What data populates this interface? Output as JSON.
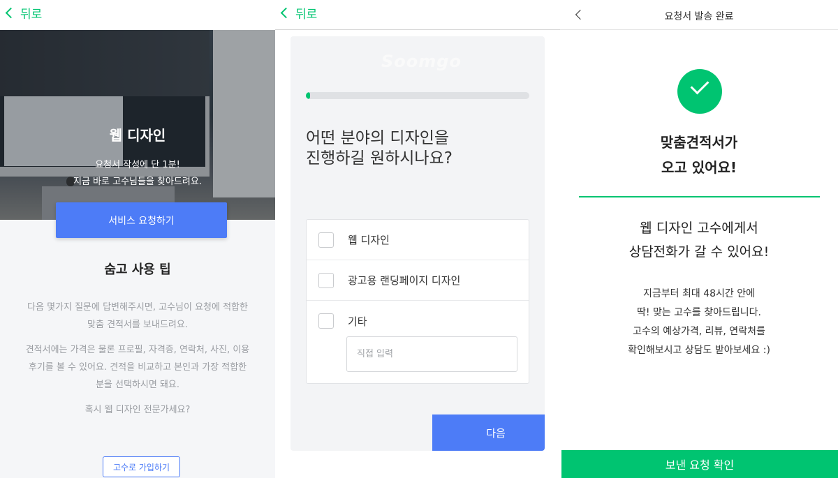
{
  "panel1": {
    "back_label": "뒤로",
    "hero": {
      "title": "웹 디자인",
      "subtitle_line1": "요청서 작성에 단 1분!",
      "subtitle_line2": "지금 바로 고수님들을 찾아드려요."
    },
    "request_button": "서비스 요청하기",
    "tips_title": "숨고 사용 팁",
    "tips": [
      {
        "line1": "다음 몇가지 질문에 답변해주시면, 고수님이 요청에 적합한",
        "line2": "맞춤 견적서를 보내드려요."
      },
      {
        "line1": "견적서에는 가격은 물론 프로필, 자격증, 연락처, 사진, 이용",
        "line2": "후기를 볼 수 있어요. 견적을 비교하고 본인과 가장 적합한",
        "line3": "분을 선택하시면 돼요."
      },
      {
        "line1": "혹시 웹 디자인 전문가세요?"
      }
    ],
    "pro_signup_button": "고수로 가입하기"
  },
  "panel2": {
    "back_label": "뒤로",
    "watermark": "Soomgo",
    "progress": 0.02,
    "question_line1": "어떤 분야의 디자인을",
    "question_line2": "진행하길 원하시나요?",
    "options": [
      {
        "label": "웹 디자인",
        "checked": false
      },
      {
        "label": "광고용 랜딩페이지 디자인",
        "checked": false
      },
      {
        "label": "기타",
        "checked": false
      }
    ],
    "direct_input_placeholder": "직접 입력",
    "next_button": "다음"
  },
  "panel3": {
    "header_title": "요청서 발송 완료",
    "headline_line1": "맞춤견적서가",
    "headline_line2": "오고 있어요!",
    "mid_line1": "웹 디자인 고수에게서",
    "mid_line2": "상담전화가 갈 수 있어요!",
    "desc_line1": "지금부터 최대 48시간 안에",
    "desc_line2": "딱! 맞는 고수를 찾아드립니다.",
    "desc_line3": "고수의 예상가격, 리뷰, 연락처를",
    "desc_line4": "확인해보시고 상담도 받아보세요 :)",
    "confirm_button": "보낸 요청 확인"
  },
  "colors": {
    "brand_green": "#00c471",
    "primary_blue": "#4d7cf7"
  },
  "icons": {
    "back": "chevron-left-icon",
    "success": "check-circle-icon"
  }
}
